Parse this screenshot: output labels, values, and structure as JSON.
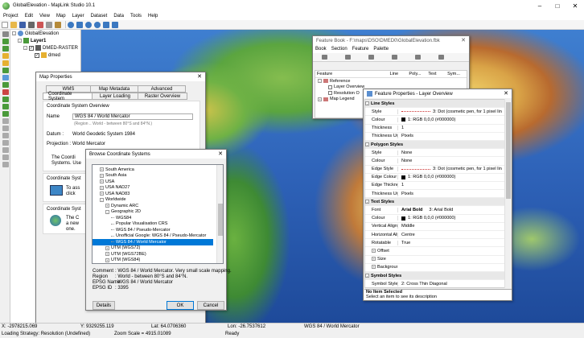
{
  "app": {
    "title": "GlobalElevation - MapLink Studio 10.1"
  },
  "menu": [
    "Project",
    "Edit",
    "View",
    "Map",
    "Layer",
    "Dataset",
    "Data",
    "Tools",
    "Help"
  ],
  "colors": {
    "accent": "#0078d7",
    "ocean": "#2e62b8"
  },
  "layers": {
    "root": "GlobalElevation",
    "layer": "Layer1",
    "raster": "DMED-RASTER",
    "item": "dmed"
  },
  "map_properties": {
    "title": "Map Properties",
    "tabs_row1": [
      "WMS",
      "Map Metadata",
      "Advanced"
    ],
    "tabs_row2": [
      "Coordinate System",
      "Layer Loading",
      "Raster Overview"
    ],
    "overview_label": "Coordinate System Overview",
    "name_label": "Name",
    "name_value": "WGS 84 / World Mercator",
    "name_sub": "(Region .. World - between 80°S and 84°N.)",
    "datum_label": "Datum :",
    "datum_value": "World Geodetic System 1984",
    "projection_label": "Projection :",
    "projection_value": "World Mercator",
    "desc_fragment1": "The Coordi",
    "desc_fragment2": "Systems. Use",
    "group2_label": "Coordinate Syst",
    "group2_text1": "To ass",
    "group2_text2": "click",
    "group3_label": "Coordinate Syst",
    "group3_text1": "The C",
    "group3_text2": "a new",
    "group3_text3": "one."
  },
  "browse_cs": {
    "title": "Browse Coordinate Systems",
    "items": [
      {
        "label": "South America",
        "indent": 1,
        "exp": "+"
      },
      {
        "label": "South Asia",
        "indent": 1,
        "exp": "+"
      },
      {
        "label": "USA",
        "indent": 1,
        "exp": "+"
      },
      {
        "label": "USA NAD27",
        "indent": 1,
        "exp": "+"
      },
      {
        "label": "USA NAD83",
        "indent": 1,
        "exp": "+"
      },
      {
        "label": "Worldwide",
        "indent": 1,
        "exp": "-"
      },
      {
        "label": "Dynamic ARC",
        "indent": 2,
        "exp": "+"
      },
      {
        "label": "Geographic 2D",
        "indent": 2,
        "exp": "-"
      },
      {
        "label": "WGS84",
        "indent": 3,
        "exp": ""
      },
      {
        "label": "Popular Visualisation CRS",
        "indent": 3,
        "exp": ""
      },
      {
        "label": "WGS 84 / Pseudo-Mercator",
        "indent": 3,
        "exp": ""
      },
      {
        "label": "Unofficial Google: WGS 84 / Pseudo-Mercator",
        "indent": 3,
        "exp": ""
      },
      {
        "label": "WGS 84 / World Mercator",
        "indent": 3,
        "exp": "",
        "selected": true
      },
      {
        "label": "UTM (WGS72)",
        "indent": 2,
        "exp": "+"
      },
      {
        "label": "UTM (WGS72BE)",
        "indent": 2,
        "exp": "+"
      },
      {
        "label": "UTM (WGS84)",
        "indent": 2,
        "exp": "+"
      }
    ],
    "comment_label": "Comment",
    "comment_value": ": WGS 84 / World Mercator. Very small scale mapping.",
    "region_label": "Region",
    "region_value": ": World - between 80°S and 84°N.",
    "epsg_name_label": "EPSG Name",
    "epsg_name_value": ": WGS 84 / World Mercator",
    "epsg_id_label": "EPSG ID",
    "epsg_id_value": ": 3395",
    "details_label": "Details",
    "ok_label": "OK",
    "cancel_label": "Cancel"
  },
  "feature_book": {
    "title": "Feature Book - F:\\maps\\DSO\\DMED0\\GlobalElevation.fbk",
    "menu": [
      "Book",
      "Section",
      "Feature",
      "Palette"
    ],
    "columns": [
      "Feature",
      "Line",
      "Poly...",
      "Text",
      "Sym..."
    ],
    "rows": [
      "Reference",
      "Layer Overview",
      "Resolution O",
      "Map Legend"
    ]
  },
  "feature_props": {
    "title": "Feature Properties - Layer Overview",
    "rows": [
      {
        "cat": "Line Styles"
      },
      {
        "k": "Style",
        "v": "3: Dot (cosmetic pen, for 1 pixel lin",
        "dash": true
      },
      {
        "k": "Colour",
        "v": "1: RGB 0,0,0 (#000000)",
        "swatch": true
      },
      {
        "k": "Thickness",
        "v": "1"
      },
      {
        "k": "Thickness Unit",
        "v": "Pixels"
      },
      {
        "cat": "Polygon Styles"
      },
      {
        "k": "Style",
        "v": "None"
      },
      {
        "k": "Colour",
        "v": "None"
      },
      {
        "k": "Edge Style",
        "v": "3: Dot (cosmetic pen, for 1 pixel lin",
        "dash": true
      },
      {
        "k": "Edge Colour",
        "v": "1: RGB 0,0,0 (#000000)",
        "swatch": true
      },
      {
        "k": "Edge Thickness",
        "v": "1"
      },
      {
        "k": "Thickness Unit",
        "v": "Pixels"
      },
      {
        "cat": "Text Styles"
      },
      {
        "k": "Font",
        "v": "Arial Bold",
        "v2": "3: Arial Bold"
      },
      {
        "k": "Colour",
        "v": "1: RGB 0,0,0 (#000000)",
        "swatch": true
      },
      {
        "k": "Vertical Alignment",
        "v": "Middle"
      },
      {
        "k": "Horizontal Alignment",
        "v": "Centre"
      },
      {
        "k": "Rotatable",
        "v": "True"
      },
      {
        "k": "Offset",
        "v": "",
        "exp": true
      },
      {
        "k": "Size",
        "v": "",
        "exp": true
      },
      {
        "k": "Background",
        "v": "",
        "exp": true
      },
      {
        "cat": "Symbol Styles"
      },
      {
        "k": "Symbol Style",
        "v": "2: Cross Thin Diagonal"
      }
    ],
    "desc_title": "No Item Selected",
    "desc_text": "Select an item to see its description"
  },
  "status": {
    "x": "X: -2978215.069",
    "y": "Y: 9329255.119",
    "lat": "Lat: 64.0706360",
    "lon": "Lon: -26.7537612",
    "crs": "WGS 84 / World Mercator",
    "strategy": "Loading Strategy: Resolution (Undefined)",
    "zoom": "Zoom Scale = 4915.01089",
    "ready": "Ready"
  }
}
